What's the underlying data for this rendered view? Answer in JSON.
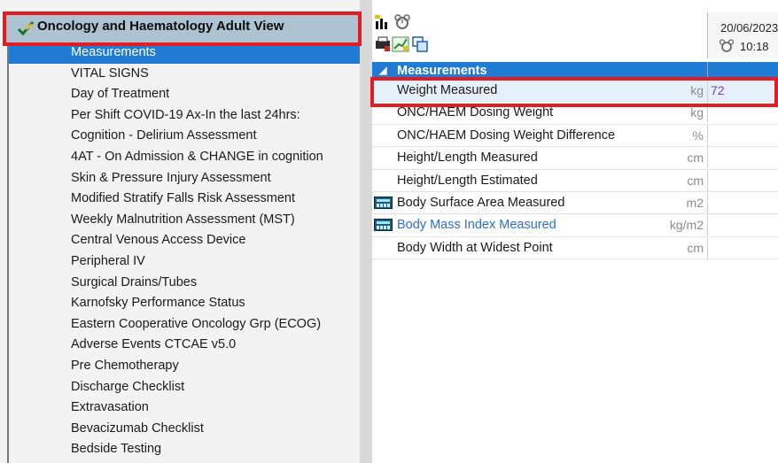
{
  "tree": {
    "header_title": "Oncology and Haematology Adult View",
    "items": [
      {
        "label": "Measurements",
        "selected": true
      },
      {
        "label": "VITAL SIGNS"
      },
      {
        "label": "Day of Treatment"
      },
      {
        "label": "Per Shift COVID-19 Ax-In the last 24hrs:"
      },
      {
        "label": "Cognition - Delirium Assessment"
      },
      {
        "label": "4AT - On Admission & CHANGE in cognition"
      },
      {
        "label": "Skin & Pressure Injury Assessment"
      },
      {
        "label": "Modified Stratify Falls Risk Assessment"
      },
      {
        "label": "Weekly Malnutrition Assessment (MST)"
      },
      {
        "label": "Central Venous Access Device"
      },
      {
        "label": "Peripheral IV"
      },
      {
        "label": "Surgical Drains/Tubes"
      },
      {
        "label": "Karnofsky Performance Status"
      },
      {
        "label": "Eastern Cooperative Oncology Grp (ECOG)"
      },
      {
        "label": "Adverse Events CTCAE v5.0"
      },
      {
        "label": "Pre Chemotherapy"
      },
      {
        "label": "Discharge Checklist"
      },
      {
        "label": "Extravasation"
      },
      {
        "label": "Bevacizumab Checklist"
      },
      {
        "label": "Bedside Testing"
      }
    ]
  },
  "column": {
    "date": "20/06/2023",
    "time": "10:18"
  },
  "section": {
    "title": "Measurements"
  },
  "rows": [
    {
      "label": "Weight Measured",
      "unit": "kg",
      "value": "72"
    },
    {
      "label": "ONC/HAEM Dosing Weight",
      "unit": "kg",
      "value": ""
    },
    {
      "label": "ONC/HAEM Dosing Weight Difference",
      "unit": "%",
      "value": ""
    },
    {
      "label": "Height/Length Measured",
      "unit": "cm",
      "value": ""
    },
    {
      "label": "Height/Length Estimated",
      "unit": "cm",
      "value": ""
    },
    {
      "label": "Body Surface Area Measured",
      "unit": "m2",
      "value": ""
    },
    {
      "label": "Body Mass Index Measured",
      "unit": "kg/m2",
      "value": ""
    },
    {
      "label": "Body Width at Widest Point",
      "unit": "cm",
      "value": ""
    }
  ],
  "colors": {
    "selection": "#1f7bd4",
    "highlight_box": "#e31b23",
    "value_text": "#7a38c9"
  }
}
